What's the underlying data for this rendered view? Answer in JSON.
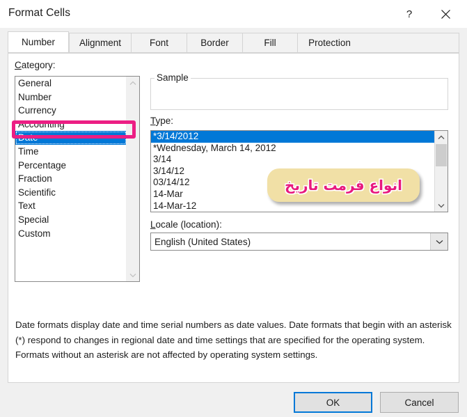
{
  "window": {
    "title": "Format Cells",
    "help_glyph": "?",
    "close_glyph": "✕"
  },
  "tabs": [
    {
      "label": "Number",
      "active": true
    },
    {
      "label": "Alignment",
      "active": false
    },
    {
      "label": "Font",
      "active": false
    },
    {
      "label": "Border",
      "active": false
    },
    {
      "label": "Fill",
      "active": false
    },
    {
      "label": "Protection",
      "active": false
    }
  ],
  "category": {
    "label_prefix": "C",
    "label_rest": "ategory:",
    "items": [
      {
        "label": "General",
        "selected": false
      },
      {
        "label": "Number",
        "selected": false
      },
      {
        "label": "Currency",
        "selected": false
      },
      {
        "label": "Accounting",
        "selected": false
      },
      {
        "label": "Date",
        "selected": true
      },
      {
        "label": "Time",
        "selected": false
      },
      {
        "label": "Percentage",
        "selected": false
      },
      {
        "label": "Fraction",
        "selected": false
      },
      {
        "label": "Scientific",
        "selected": false
      },
      {
        "label": "Text",
        "selected": false
      },
      {
        "label": "Special",
        "selected": false
      },
      {
        "label": "Custom",
        "selected": false
      }
    ]
  },
  "sample": {
    "legend": "Sample",
    "value": ""
  },
  "type": {
    "label_prefix": "T",
    "label_rest": "ype:",
    "items": [
      {
        "label": "*3/14/2012",
        "selected": true
      },
      {
        "label": "*Wednesday, March 14, 2012",
        "selected": false
      },
      {
        "label": "3/14",
        "selected": false
      },
      {
        "label": "3/14/12",
        "selected": false
      },
      {
        "label": "03/14/12",
        "selected": false
      },
      {
        "label": "14-Mar",
        "selected": false
      },
      {
        "label": "14-Mar-12",
        "selected": false
      }
    ]
  },
  "locale": {
    "label_prefix": "L",
    "label_rest": "ocale (location):",
    "value": "English (United States)"
  },
  "description": "Date formats display date and time serial numbers as date values.  Date formats that begin with an asterisk (*) respond to changes in regional date and time settings that are specified for the operating system. Formats without an asterisk are not affected by operating system settings.",
  "footer": {
    "ok_label": "OK",
    "cancel_label": "Cancel"
  },
  "annotations": {
    "highlight_target": "Date",
    "bubble_text": "انواع فرمت تاریخ",
    "outline_color": "#ec1e84",
    "bubble_fill": "#f1e0a6",
    "bubble_text_color": "#e8197e"
  },
  "colors": {
    "selection_blue": "#0078d7",
    "dialog_bg": "#f0f0f0",
    "panel_bg": "#ffffff",
    "focus_border": "#0078d7"
  }
}
